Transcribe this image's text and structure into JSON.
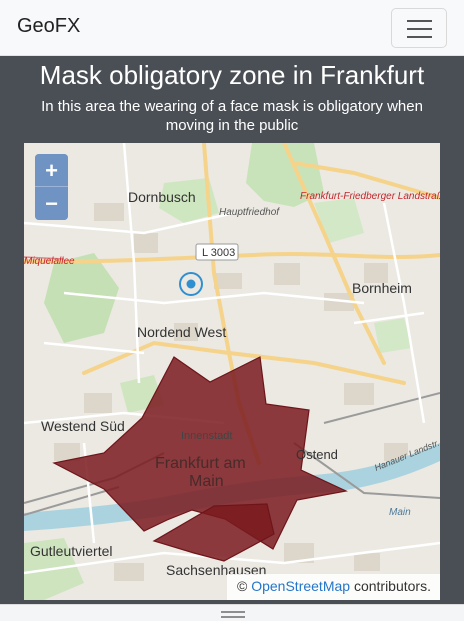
{
  "navbar": {
    "brand": "GeoFX",
    "menu_icon": "hamburger-icon"
  },
  "main": {
    "title": "Mask obligatory zone in Frankfurt",
    "subtitle": "In this area the wearing of a face mask is obligatory when moving in the public"
  },
  "map": {
    "zoom_in_label": "+",
    "zoom_out_label": "−",
    "labels": {
      "dornbusch": "Dornbusch",
      "hauptfriedhof": "Hauptfriedhof",
      "road_l3003": "L 3003",
      "landstrasse": "Frankfurt-Friedberger Landstraße",
      "miquelallee": "Miquelallee",
      "bornheim": "Bornheim",
      "nordend_west": "Nordend West",
      "innenstadt": "Innenstadt",
      "westend_sued": "Westend Süd",
      "frankfurt_am_main_1": "Frankfurt am",
      "frankfurt_am_main_2": "Main",
      "ostend": "Ostend",
      "main_river": "Main",
      "gutleutviertel": "Gutleutviertel",
      "sachsenhausen": "Sachsenhausen",
      "hanauer": "Hanauer Landstr."
    },
    "attribution_prefix": "© ",
    "attribution_link": "OpenStreetMap",
    "attribution_suffix": " contributors.",
    "location_icon": "location-marker-icon",
    "zone_color": "#7a1a1f"
  },
  "footer": {
    "handle_icon": "drag-handle-icon"
  }
}
